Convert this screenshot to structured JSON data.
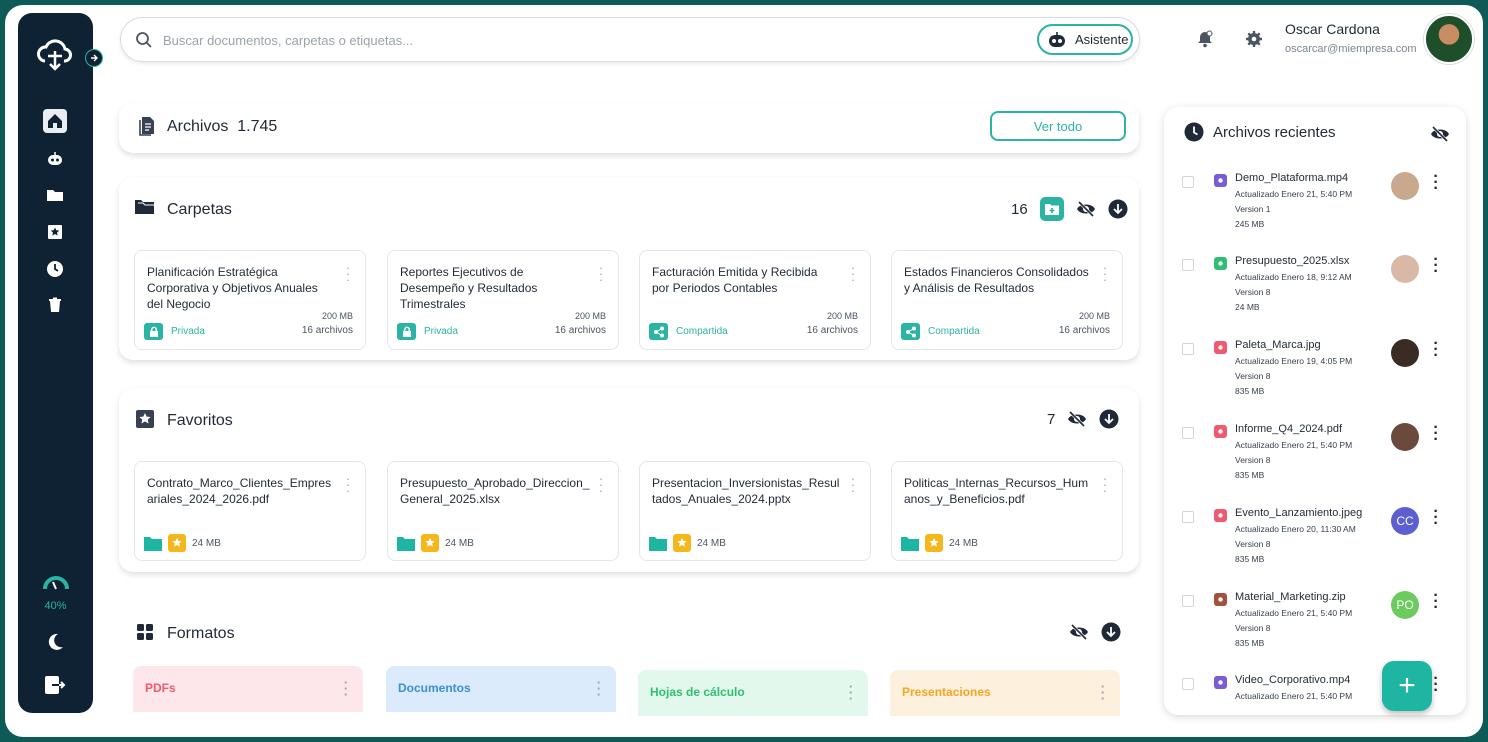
{
  "sidebar": {
    "storage_percent_label": "40%",
    "nav": [
      "home-icon",
      "bot-icon",
      "folders-icon",
      "star-icon",
      "clock-icon",
      "trash-icon"
    ]
  },
  "header": {
    "search_placeholder": "Buscar documentos, carpetas o etiquetas...",
    "assistant_label": "Asistente",
    "user_name": "Oscar Cardona",
    "user_email": "oscarcar@miempresa.com"
  },
  "archivos": {
    "title": "Archivos",
    "count": "1.745",
    "view_all": "Ver todo"
  },
  "carpetas": {
    "title": "Carpetas",
    "count": "16",
    "items": [
      {
        "title": "Planificación Estratégica Corporativa y Objetivos Anuales del Negocio",
        "size": "200 MB",
        "files": "16 archivos",
        "tag": "Privada"
      },
      {
        "title": "Reportes Ejecutivos de Desempeño y Resultados Trimestrales",
        "size": "200 MB",
        "files": "16 archivos",
        "tag": "Privada"
      },
      {
        "title": "Facturación Emitida y Recibida por Periodos Contables",
        "size": "200 MB",
        "files": "16 archivos",
        "tag": "Compartida"
      },
      {
        "title": "Estados Financieros Consolidados y Análisis de Resultados",
        "size": "200 MB",
        "files": "16 archivos",
        "tag": "Compartida"
      }
    ]
  },
  "favoritos": {
    "title": "Favoritos",
    "count": "7",
    "items": [
      {
        "title": "Contrato_Marco_Clientes_Empresariales_2024_2026.pdf",
        "size": "24 MB"
      },
      {
        "title": "Presupuesto_Aprobado_Direccion_General_2025.xlsx",
        "size": "24 MB"
      },
      {
        "title": "Presentacion_Inversionistas_Resultados_Anuales_2024.pptx",
        "size": "24 MB"
      },
      {
        "title": "Politicas_Internas_Recursos_Humanos_y_Beneficios.pdf",
        "size": "24 MB"
      }
    ]
  },
  "formatos": {
    "title": "Formatos",
    "items": [
      {
        "label": "PDFs",
        "color": "#f05a6e",
        "bg": "#fde7ea"
      },
      {
        "label": "Documentos",
        "color": "#3b8fd6",
        "bg": "#dcebfb"
      },
      {
        "label": "Hojas de cálculo",
        "color": "#2fbf71",
        "bg": "#e3f8ec"
      },
      {
        "label": "Presentaciones",
        "color": "#f5a623",
        "bg": "#fdf0dc"
      }
    ]
  },
  "recientes": {
    "title": "Archivos recientes",
    "items": [
      {
        "name": "Demo_Plataforma.mp4",
        "updated": "Actualizado Enero 21, 5:40 PM",
        "version": "Version 1",
        "size": "245 MB",
        "icon_color": "#7c5cd6",
        "avatar": "",
        "avatar_bg": "#c9a98e"
      },
      {
        "name": "Presupuesto_2025.xlsx",
        "updated": "Actualizado Enero 18, 9:12 AM",
        "version": "Version 8",
        "size": "24 MB",
        "icon_color": "#2fbf71",
        "avatar": "",
        "avatar_bg": "#d9b8a6"
      },
      {
        "name": "Paleta_Marca.jpg",
        "updated": "Actualizado Enero 19, 4:05 PM",
        "version": "Version 8",
        "size": "835 MB",
        "icon_color": "#f05a6e",
        "avatar": "",
        "avatar_bg": "#3a2b24"
      },
      {
        "name": "Informe_Q4_2024.pdf",
        "updated": "Actualizado Enero 21, 5:40 PM",
        "version": "Version 8",
        "size": "835 MB",
        "icon_color": "#f05a6e",
        "avatar": "",
        "avatar_bg": "#6b4a3d"
      },
      {
        "name": "Evento_Lanzamiento.jpeg",
        "updated": "Actualizado Enero 20, 11:30 AM",
        "version": "Version 8",
        "size": "835 MB",
        "icon_color": "#f05a6e",
        "avatar": "CC",
        "avatar_bg": "#5b5fd1"
      },
      {
        "name": "Material_Marketing.zip",
        "updated": "Actualizado Enero 21, 5:40 PM",
        "version": "Version 8",
        "size": "835 MB",
        "icon_color": "#a0523d",
        "avatar": "PO",
        "avatar_bg": "#6ccb5f"
      },
      {
        "name": "Video_Corporativo.mp4",
        "updated": "Actualizado Enero 21, 5:40 PM",
        "version": "",
        "size": "",
        "icon_color": "#7c5cd6",
        "avatar": "",
        "avatar_bg": ""
      }
    ]
  },
  "fab_label": "+"
}
